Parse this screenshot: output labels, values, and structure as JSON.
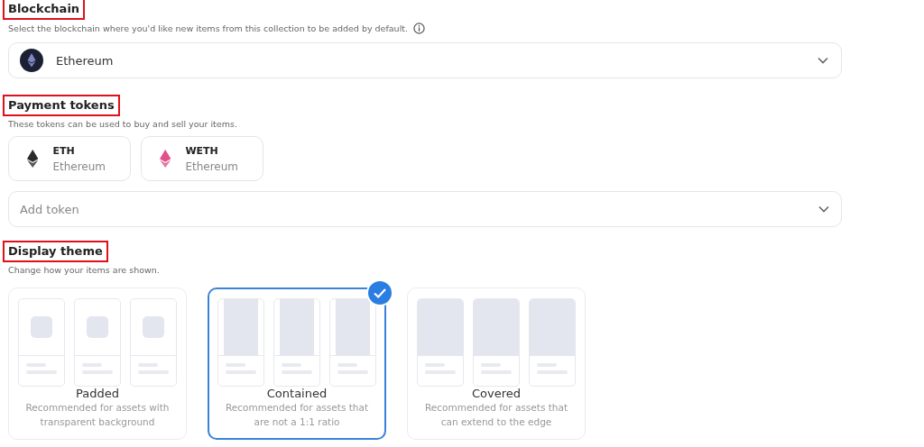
{
  "blockchain": {
    "title": "Blockchain",
    "highlighted": true,
    "description": "Select the blockchain where you'd like new items from this collection to be added by default.",
    "value": "Ethereum"
  },
  "payment_tokens": {
    "title": "Payment tokens",
    "highlighted": true,
    "description": "These tokens can be used to buy and sell your items.",
    "tokens": [
      {
        "symbol": "ETH",
        "network": "Ethereum",
        "color": "#2b2b2b"
      },
      {
        "symbol": "WETH",
        "network": "Ethereum",
        "color": "#e0508a"
      }
    ],
    "add_placeholder": "Add token"
  },
  "display_theme": {
    "title": "Display theme",
    "highlighted": true,
    "description": "Change how your items are shown.",
    "options": [
      {
        "kind": "padded",
        "name": "Padded",
        "description": "Recommended for assets with transparent background",
        "selected": false
      },
      {
        "kind": "contained",
        "name": "Contained",
        "description": "Recommended for assets that are not a 1:1 ratio",
        "selected": true
      },
      {
        "kind": "covered",
        "name": "Covered",
        "description": "Recommended for assets that can extend to the edge",
        "selected": false
      }
    ]
  }
}
